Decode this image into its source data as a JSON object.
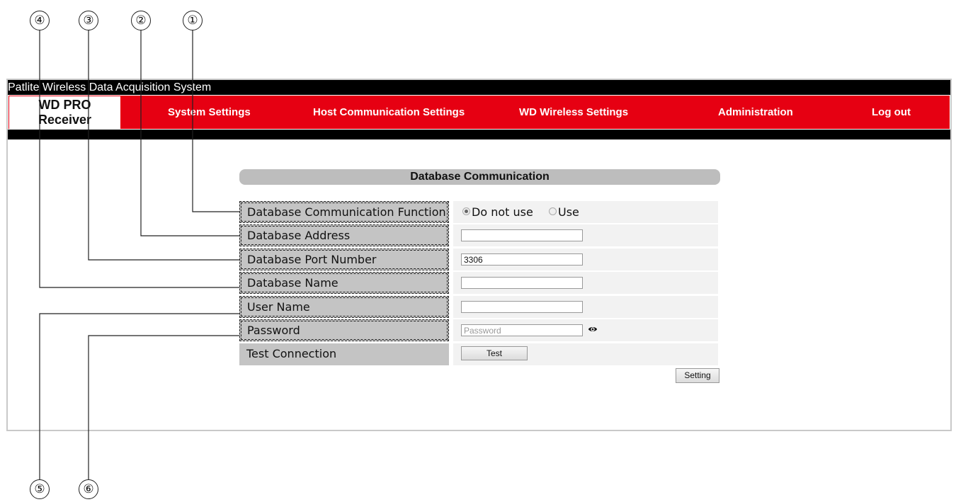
{
  "callouts": [
    "①",
    "②",
    "③",
    "④",
    "⑤",
    "⑥"
  ],
  "app": {
    "title": "Patlite Wireless Data Acquisition System",
    "logo_line1": "WD PRO",
    "logo_line2": "Receiver"
  },
  "nav": {
    "items": [
      "System Settings",
      "Host Communication Settings",
      "WD Wireless Settings",
      "Administration",
      "Log out"
    ]
  },
  "colors": {
    "brand_red": "#e60012",
    "header_black": "#000000",
    "label_gray": "#c4c4c4",
    "field_gray": "#f2f2f2"
  },
  "panel": {
    "title": "Database Communication",
    "rows": [
      {
        "label": "Database Communication Function"
      },
      {
        "label": "Database Address",
        "value": ""
      },
      {
        "label": "Database Port Number",
        "value": "3306"
      },
      {
        "label": "Database Name",
        "value": ""
      },
      {
        "label": "User Name",
        "value": ""
      },
      {
        "label": "Password",
        "placeholder": "Password"
      },
      {
        "label": "Test Connection"
      }
    ],
    "radio": {
      "options": [
        "Do not use",
        "Use"
      ],
      "selected": "Do not use"
    },
    "test_button": "Test",
    "setting_button": "Setting",
    "password_toggle_icon": "eye-icon"
  }
}
